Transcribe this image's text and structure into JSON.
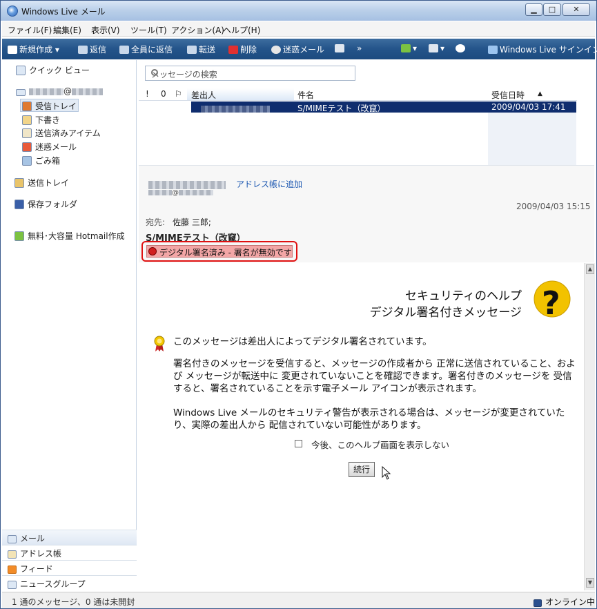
{
  "window": {
    "title": "Windows Live メール",
    "min": "▁",
    "max": "□",
    "close": "✕"
  },
  "menu": [
    "ファイル(F)",
    "編集(E)",
    "表示(V)",
    "ツール(T)",
    "アクション(A)",
    "ヘルプ(H)"
  ],
  "toolbar": {
    "new": "新規作成",
    "reply": "返信",
    "reply_all": "全員に返信",
    "forward": "転送",
    "delete": "削除",
    "junk": "迷惑メール",
    "more": "»",
    "signin": "Windows Live サインイン"
  },
  "left": {
    "quick_views": "クイック ビュー",
    "account_at": "@",
    "inbox": "受信トレイ",
    "drafts": "下書き",
    "sent": "送信済みアイテム",
    "junk": "迷惑メール",
    "trash": "ごみ箱",
    "outbox": "送信トレイ",
    "storage": "保存フォルダ",
    "hotmail": "無料･大容量 Hotmail作成",
    "nav": {
      "mail": "メール",
      "contacts": "アドレス帳",
      "feeds": "フィード",
      "newsgroups": "ニュースグループ"
    }
  },
  "search": {
    "placeholder": "メッセージの検索"
  },
  "list": {
    "columns": {
      "importance": "!",
      "attach": "0",
      "flag": "⚐",
      "sender": "差出人",
      "subject": "件名",
      "date": "受信日時",
      "sort_arrow": "▲"
    },
    "rows": [
      {
        "subject": "S/MIMEテスト（改竄）",
        "date": "2009/04/03 17:41"
      }
    ]
  },
  "preview": {
    "add_contact": "アドレス帳に追加",
    "from_at": "@",
    "date": "2009/04/03 15:15",
    "to_label": "宛先:",
    "to_value": "佐藤 三郎;",
    "subject": "S/MIMEテスト（改竄）",
    "sig_warning": "デジタル署名済み - 署名が無効です"
  },
  "help": {
    "title1": "セキュリティのヘルプ",
    "title2": "デジタル署名付きメッセージ",
    "lead": "このメッセージは差出人によってデジタル署名されています。",
    "para1": "署名付きのメッセージを受信すると、メッセージの作成者から 正常に送信されていること、および メッセージが転送中に 変更されていないことを確認できます。署名付きのメッセージを 受信すると、署名されていることを示す電子メール アイコンが表示されます。",
    "para2": "Windows Live メールのセキュリティ警告が表示される場合は、メッセージが変更されていたり、実際の差出人から 配信されていない可能性があります。",
    "checkbox": "今後、このヘルプ画面を表示しない",
    "continue": "続行"
  },
  "status": {
    "left": "1 通のメッセージ、0 通は未開封",
    "right": "オンライン中"
  }
}
